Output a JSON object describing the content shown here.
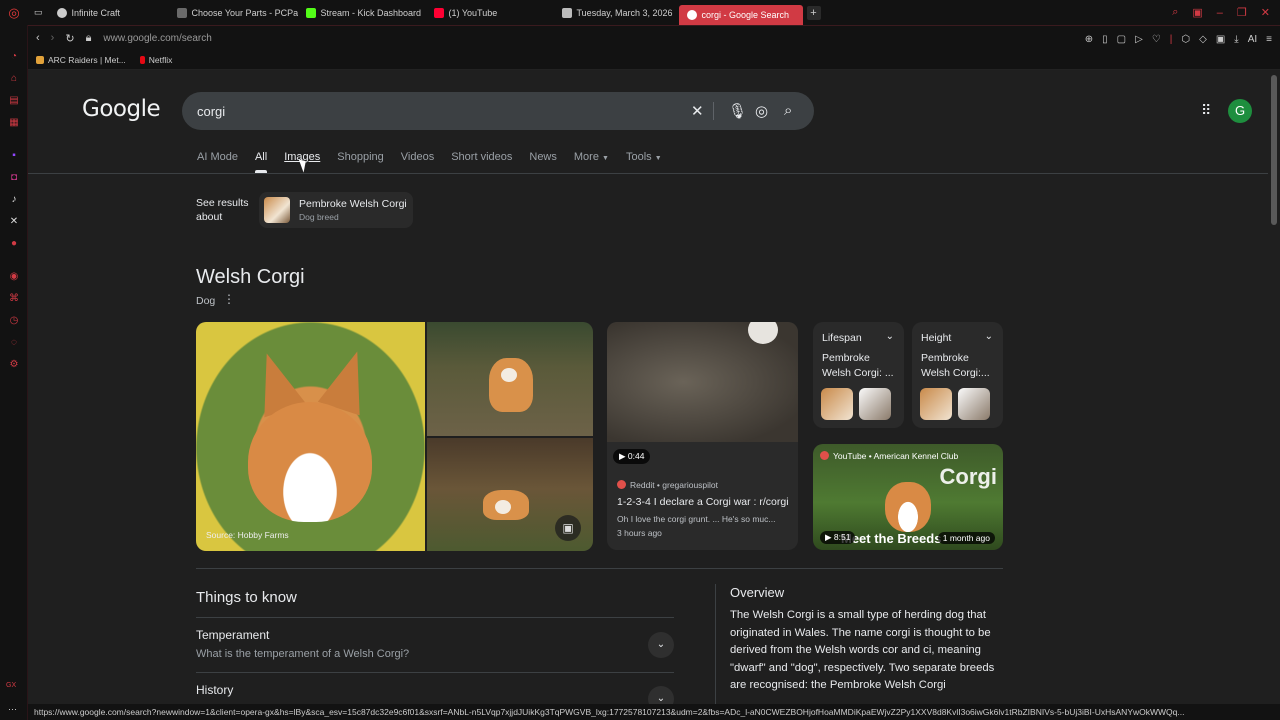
{
  "browser": {
    "tabs": [
      {
        "label": "Infinite Craft",
        "color": "#cccccc"
      },
      {
        "label": "Choose Your Parts - PCPa",
        "color": "#6a6a6a"
      },
      {
        "label": "Stream - Kick Dashboard",
        "color": "#53fc18"
      },
      {
        "label": "(1) YouTube",
        "color": "#ff0033"
      },
      {
        "label": "Tuesday, March 3, 2026",
        "color": "#bbbbbb"
      },
      {
        "label": "corgi - Google Search",
        "color": "#ffffff"
      }
    ],
    "url": "www.google.com/search",
    "bookmarks": [
      {
        "label": "ARC Raiders | Met...",
        "color": "#e2a23a"
      },
      {
        "label": "Netflix",
        "color": "#e50914"
      }
    ],
    "status_url": "https://www.google.com/search?newwindow=1&client=opera-gx&hs=lBy&sca_esv=15c87dc32e9c6f01&sxsrf=ANbL-n5LVqp7xjjdJUikKg3TqPWGVB_lxg:1772578107213&udm=2&fbs=ADc_l-aN0CWEZBOHjofHoaMMDiKpaEWjvZ2Py1XXV8d8KvlI3o6iwGk6lv1tRbZIBNIVs-5-bUj3iBI-UxHsANYwOkWWQq...",
    "accent": "#d13a44"
  },
  "google": {
    "logo": "Google",
    "query": "corgi",
    "avatar_letter": "G",
    "tabs": [
      "AI Mode",
      "All",
      "Images",
      "Shopping",
      "Videos",
      "Short videos",
      "News",
      "More",
      "Tools"
    ]
  },
  "see_results": {
    "label": "See results about",
    "entity": "Pembroke Welsh Corgi",
    "type": "Dog breed"
  },
  "knowledge": {
    "title": "Welsh Corgi",
    "subtitle": "Dog",
    "image_source": "Source: Hobby Farms",
    "video": {
      "duration": "0:44",
      "source": "Reddit • gregariouspilot",
      "title": "1-2-3-4 I declare a Corgi war : r/corgi",
      "snippet": "Oh I love the corgi grunt. ... He's so muc...",
      "ago": "3 hours ago"
    },
    "attrs": [
      {
        "label": "Lifespan",
        "value": "Pembroke Welsh Corgi: ..."
      },
      {
        "label": "Height",
        "value": "Pembroke Welsh Corgi:..."
      }
    ],
    "yt": {
      "source": "YouTube • American Kennel Club",
      "overlay_top": "Corgi",
      "overlay_bottom": "Meet the Breeds",
      "duration": "8:51",
      "ago": "1 month ago"
    }
  },
  "things_to_know": {
    "title": "Things to know",
    "items": [
      {
        "title": "Temperament",
        "question": "What is the temperament of a Welsh Corgi?"
      },
      {
        "title": "History",
        "question": ""
      }
    ]
  },
  "overview": {
    "title": "Overview",
    "text": "The Welsh Corgi is a small type of herding dog that originated in Wales. The name corgi is thought to be derived from the Welsh words cor and ci, meaning \"dwarf\" and \"dog\", respectively. Two separate breeds are recognised: the Pembroke Welsh Corgi"
  },
  "sidebar_brand": "GX"
}
